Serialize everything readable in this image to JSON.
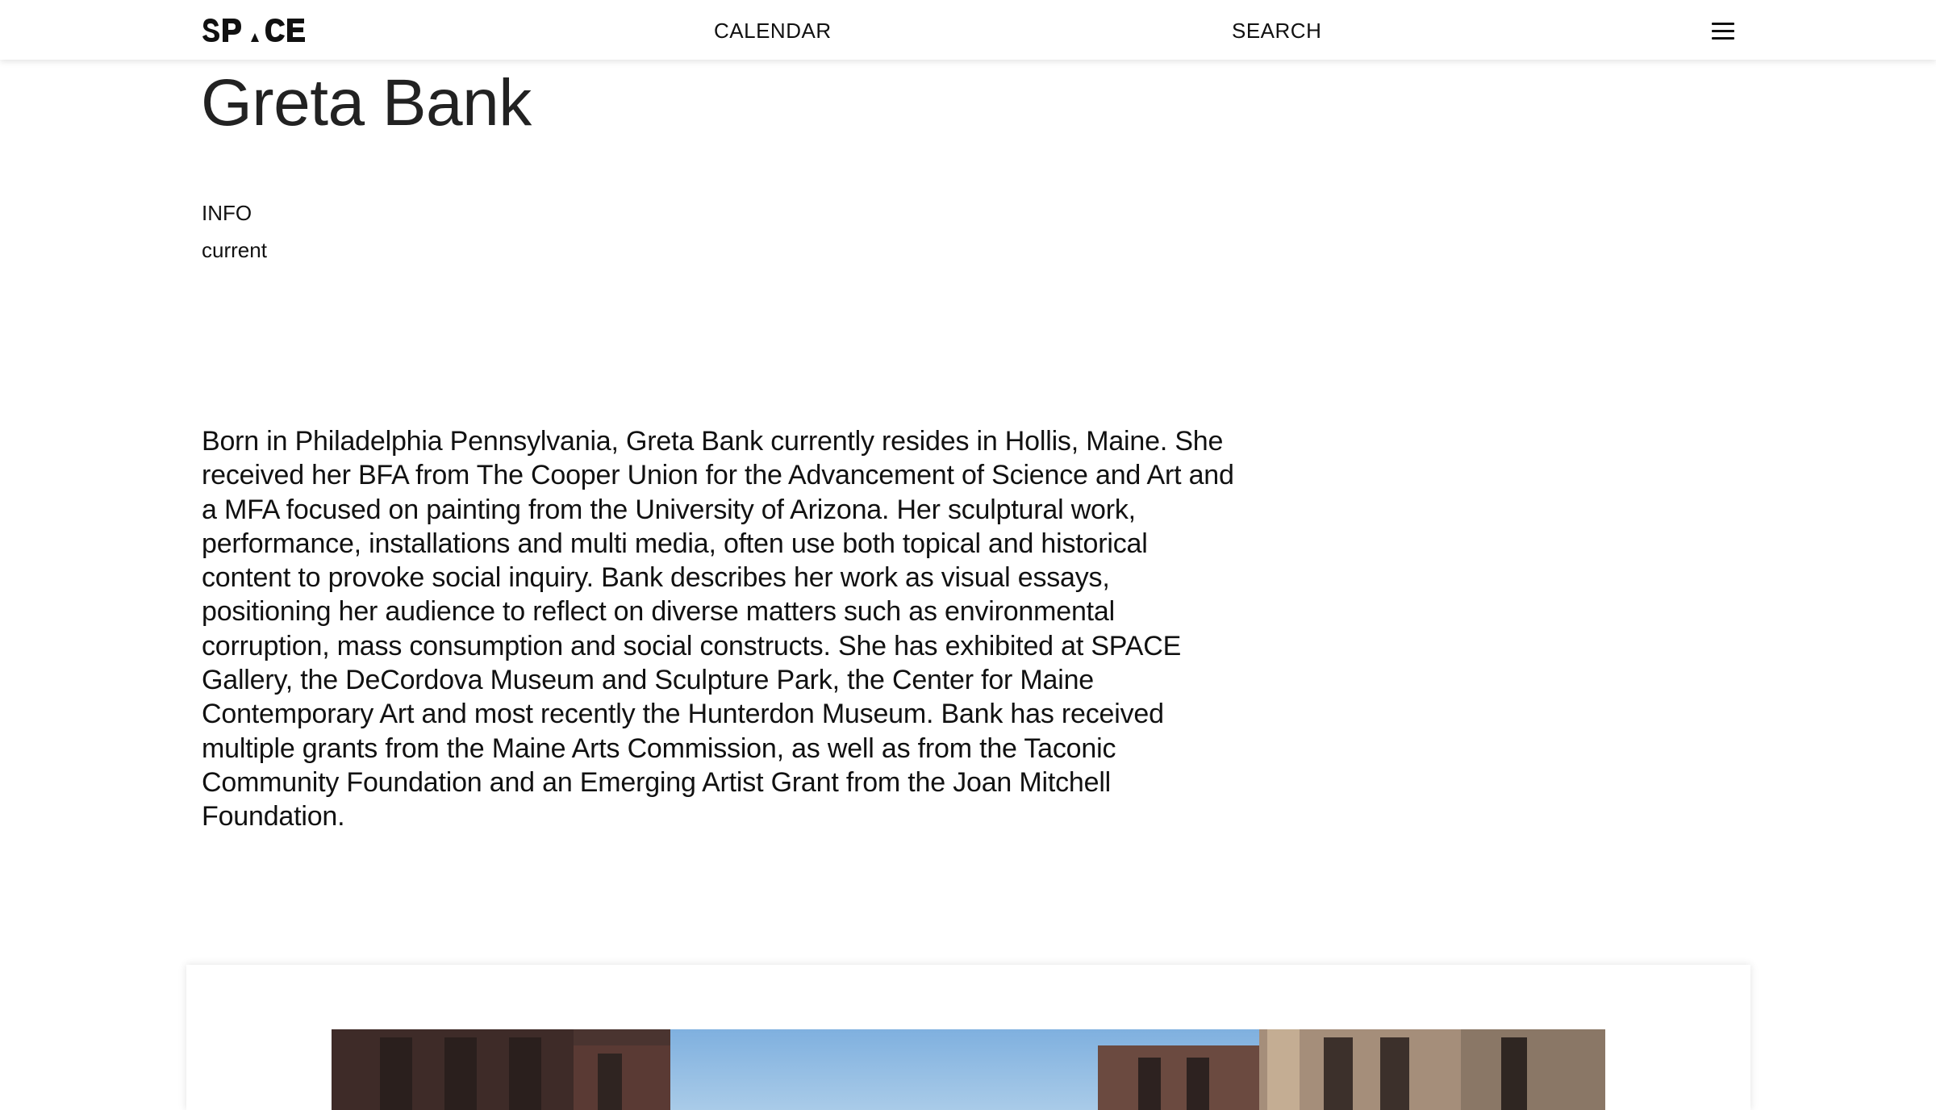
{
  "header": {
    "logo_text": "SPACE",
    "nav": {
      "calendar": "CALENDAR",
      "search": "SEARCH"
    },
    "menu_icon": "hamburger-icon"
  },
  "artist": {
    "name": "Greta Bank",
    "info_label": "INFO",
    "status": "current",
    "bio": "Born in Philadelphia Pennsylvania, Greta Bank currently resides in Hollis, Maine. She received her BFA from The Cooper Union for the Advancement of Science and Art and a MFA focused on painting from the University of Arizona. Her sculptural work, performance, installations and multi media, often use both topical and historical content to provoke social inquiry. Bank describes her work as visual essays, positioning her audience to reflect on diverse matters such as environmental corruption, mass consumption and social constructs. She has exhibited at SPACE Gallery, the DeCordova Museum and Sculpture Park, the Center for Maine Contemporary Art and most recently the Hunterdon Museum. Bank has received multiple grants from the Maine Arts Commission, as well as from the Taconic Community Foundation and an Emerging Artist Grant from the Joan Mitchell Foundation."
  },
  "colors": {
    "text": "#111111",
    "sky": "#8fb7dc",
    "brick": "#5a3a34"
  }
}
